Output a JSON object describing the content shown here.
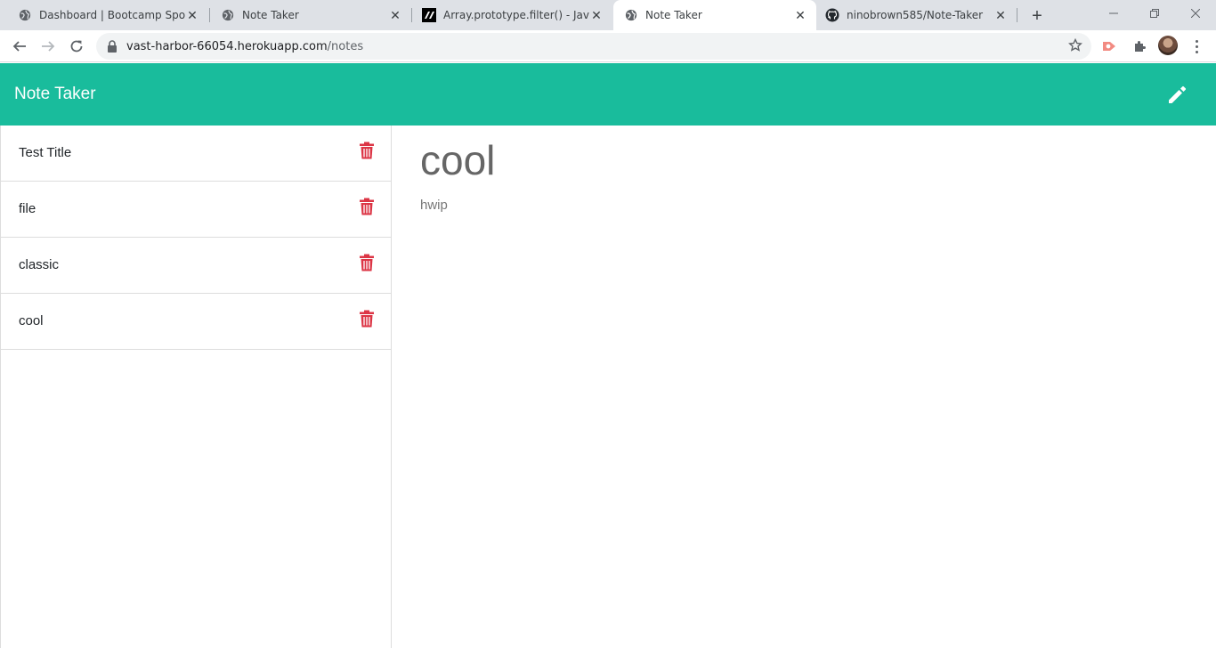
{
  "browser": {
    "tabs": [
      {
        "title": "Dashboard | Bootcamp Spot",
        "icon": "globe-icon",
        "active": false
      },
      {
        "title": "Note Taker",
        "icon": "globe-icon",
        "active": false
      },
      {
        "title": "Array.prototype.filter() - JavaSc",
        "icon": "mdn-icon",
        "active": false
      },
      {
        "title": "Note Taker",
        "icon": "globe-icon",
        "active": true
      },
      {
        "title": "ninobrown585/Note-Taker",
        "icon": "github-icon",
        "active": false
      }
    ],
    "url_host": "vast-harbor-66054.herokuapp.com",
    "url_path": "/notes"
  },
  "app": {
    "title": "Note Taker",
    "accent_color": "#19bc9c",
    "delete_color": "#dc3545",
    "notes": [
      {
        "title": "Test Title"
      },
      {
        "title": "file"
      },
      {
        "title": "classic"
      },
      {
        "title": "cool"
      }
    ],
    "active_note": {
      "title": "cool",
      "text": "hwip"
    }
  }
}
